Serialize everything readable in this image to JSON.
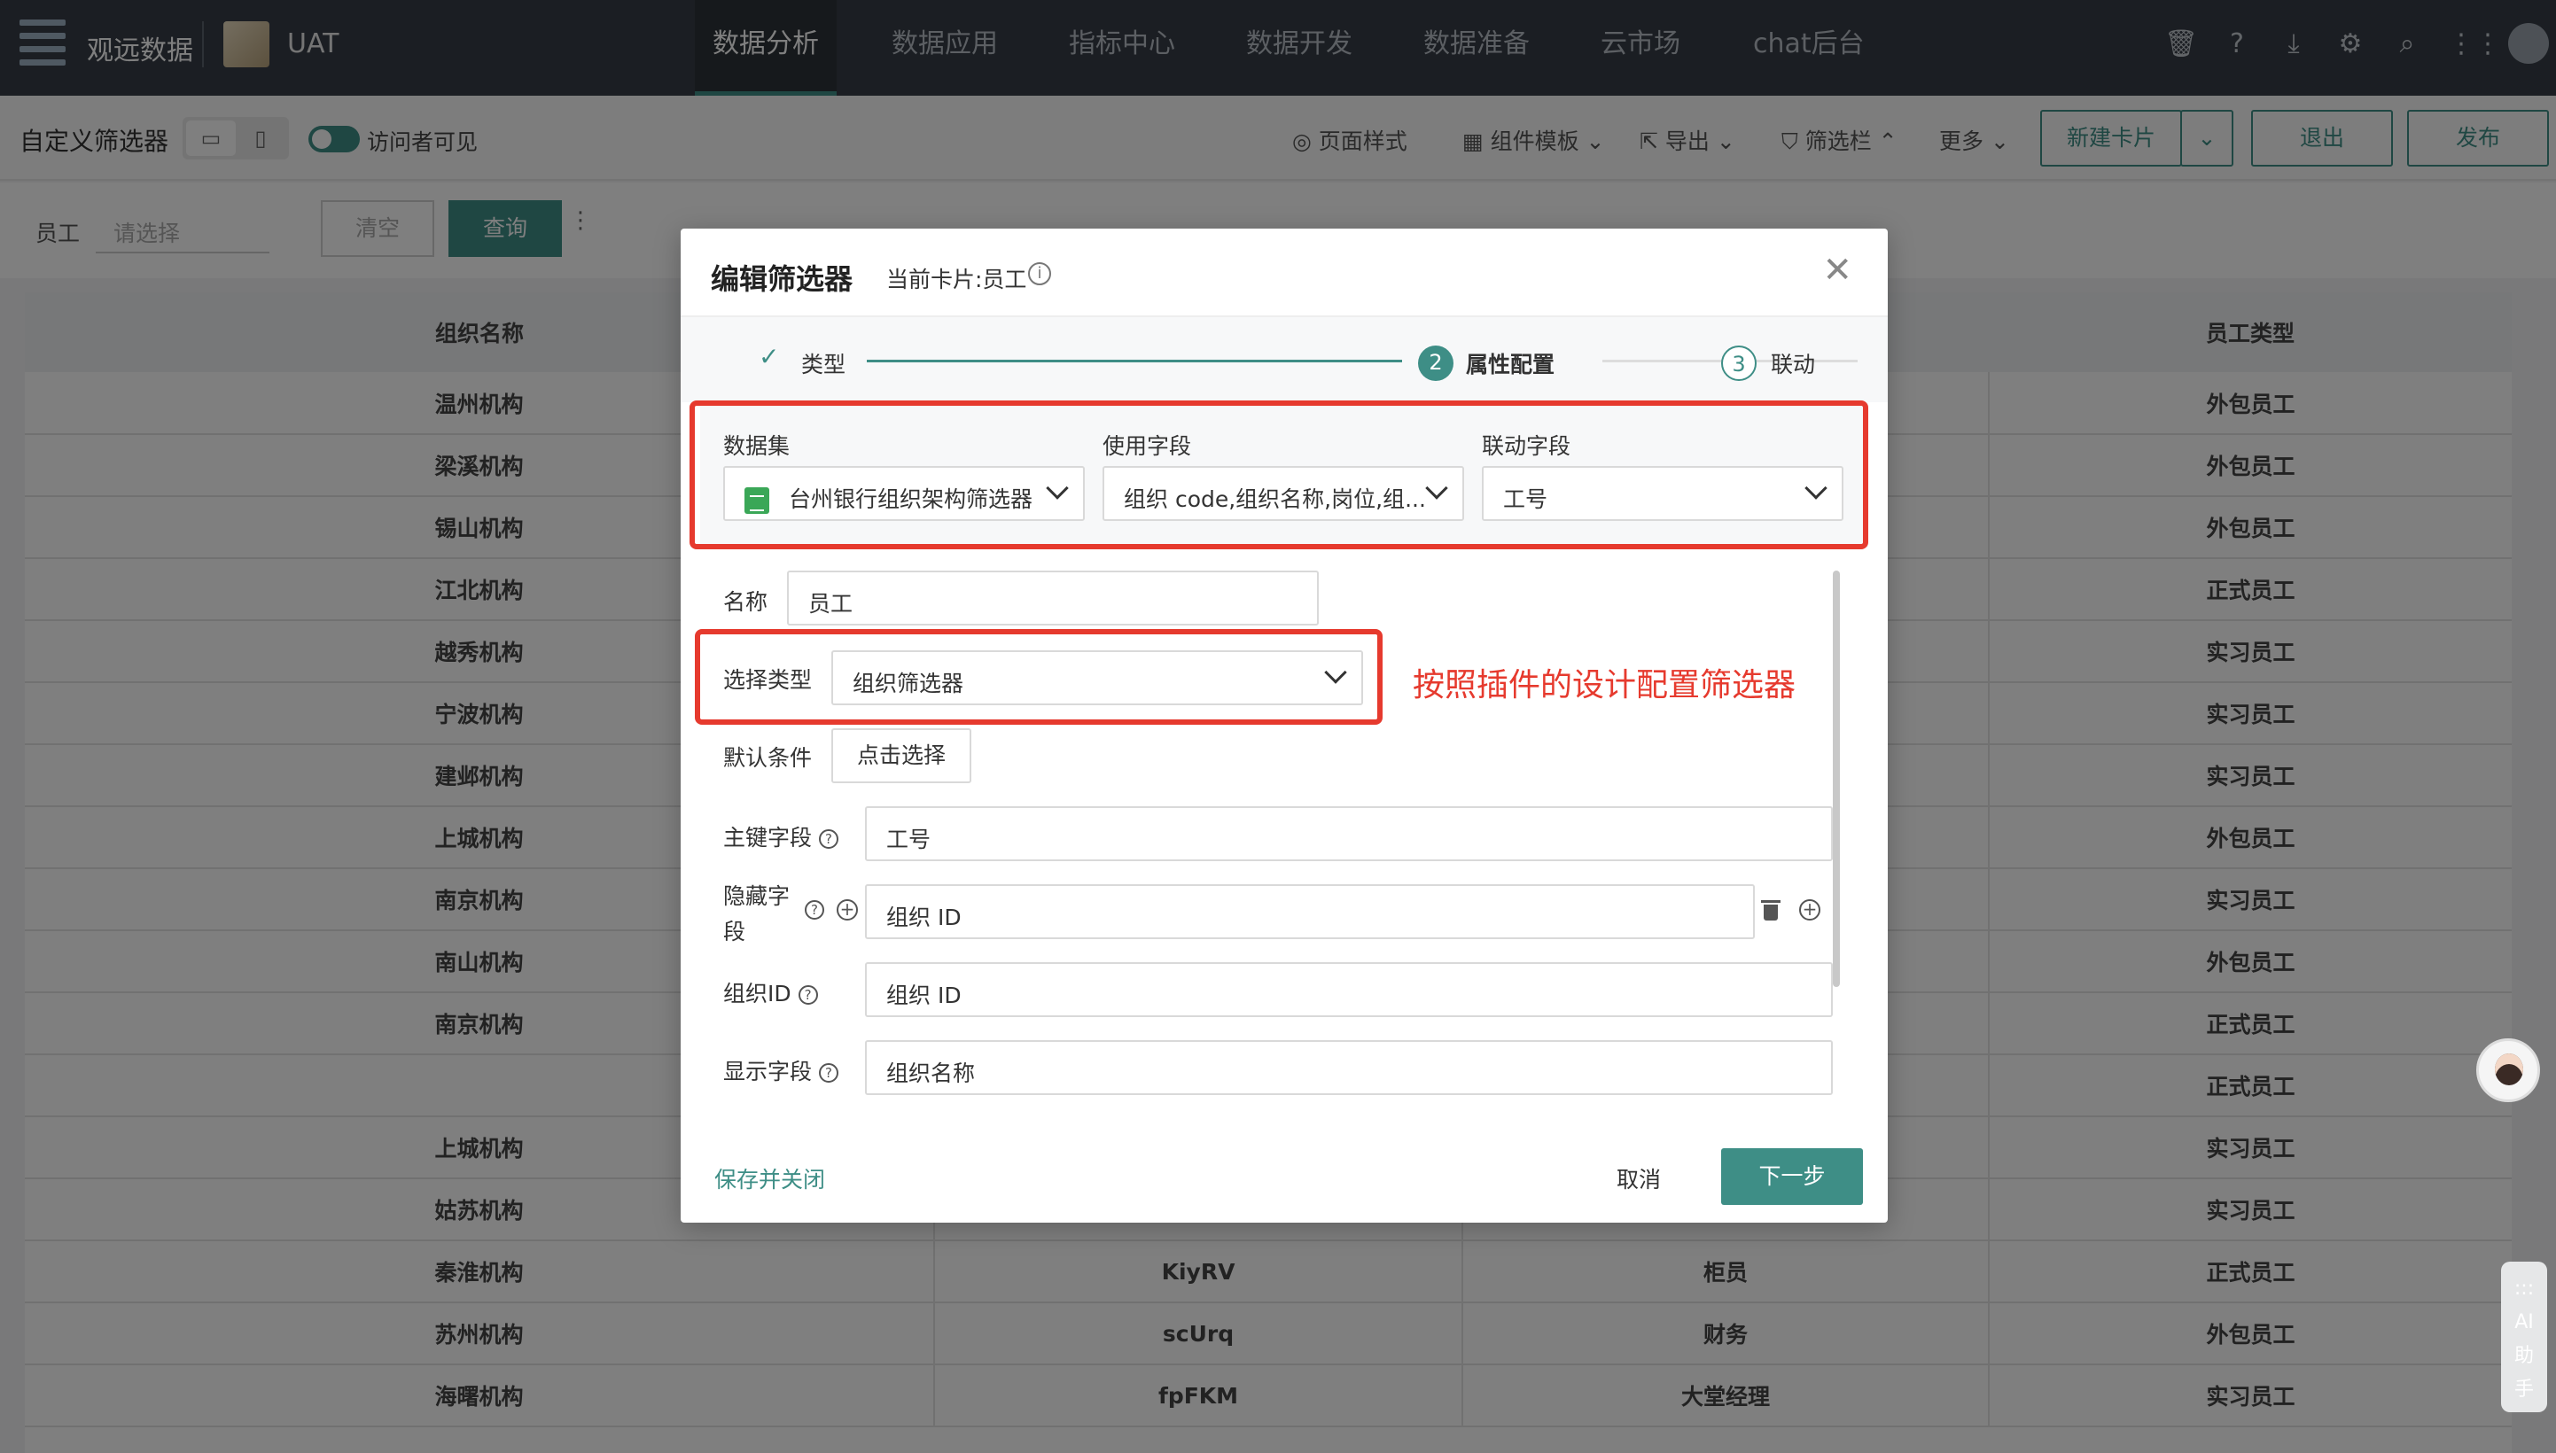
{
  "topbar": {
    "brand": "观远数据",
    "env": "UAT",
    "nav": [
      "数据分析",
      "数据应用",
      "指标中心",
      "数据开发",
      "数据准备",
      "云市场",
      "chat后台"
    ],
    "icons": [
      "trash-icon",
      "help-icon",
      "download-icon",
      "settings-icon",
      "search-icon",
      "apps-grid-icon",
      "user-avatar"
    ]
  },
  "toolbar": {
    "page_name": "自定义筛选器",
    "visitor_visible": "访问者可见",
    "page_style": "页面样式",
    "component_template": "组件模板",
    "export": "导出",
    "filter_bar": "筛选栏",
    "more": "更多",
    "new_card": "新建卡片",
    "exit": "退出",
    "publish": "发布"
  },
  "filterbar": {
    "label": "员工",
    "placeholder": "请选择",
    "clear": "清空",
    "query": "查询"
  },
  "table": {
    "headers": [
      "组织名称",
      "",
      "",
      "员工类型"
    ],
    "rows": [
      [
        "温州机构",
        "",
        "",
        "外包员工"
      ],
      [
        "梁溪机构",
        "",
        "",
        "外包员工"
      ],
      [
        "锡山机构",
        "",
        "",
        "外包员工"
      ],
      [
        "江北机构",
        "",
        "",
        "正式员工"
      ],
      [
        "越秀机构",
        "",
        "",
        "实习员工"
      ],
      [
        "宁波机构",
        "",
        "",
        "实习员工"
      ],
      [
        "建邺机构",
        "",
        "",
        "实习员工"
      ],
      [
        "上城机构",
        "",
        "",
        "外包员工"
      ],
      [
        "南京机构",
        "",
        "",
        "实习员工"
      ],
      [
        "南山机构",
        "",
        "",
        "外包员工"
      ],
      [
        "南京机构",
        "",
        "",
        "正式员工"
      ],
      [
        "",
        "",
        "",
        "正式员工"
      ],
      [
        "上城机构",
        "",
        "",
        "实习员工"
      ],
      [
        "姑苏机构",
        "",
        "",
        "实习员工"
      ],
      [
        "秦淮机构",
        "KiyRV",
        "柜员",
        "正式员工"
      ],
      [
        "苏州机构",
        "scUrq",
        "财务",
        "外包员工"
      ],
      [
        "海曙机构",
        "fpFKM",
        "大堂经理",
        "实习员工"
      ]
    ]
  },
  "modal": {
    "title": "编辑筛选器",
    "subtitle": "当前卡片:员工",
    "steps": [
      {
        "num": "",
        "label": "类型"
      },
      {
        "num": "2",
        "label": "属性配置"
      },
      {
        "num": "3",
        "label": "联动"
      }
    ],
    "dataset_label": "数据集",
    "dataset_value": "台州银行组织架构筛选器",
    "fields_label": "使用字段",
    "fields_value": "组织 code,组织名称,岗位,组...",
    "link_label": "联动字段",
    "link_value": "工号",
    "name_label": "名称",
    "name_value": "员工",
    "select_type_label": "选择类型",
    "select_type_value": "组织筛选器",
    "default_cond_label": "默认条件",
    "default_cond_btn": "点击选择",
    "pk_label": "主键字段",
    "pk_value": "工号",
    "hidden_label_1": "隐藏字",
    "hidden_label_2": "段",
    "hidden_value": "组织 ID",
    "orgid_label": "组织ID",
    "orgid_value": "组织 ID",
    "display_label": "显示字段",
    "display_value": "组织名称",
    "save_close": "保存并关闭",
    "cancel": "取消",
    "next": "下一步"
  },
  "annotation": "按照插件的设计配置筛选器",
  "ai_helper": {
    "dots": ":::",
    "label_1": "AI",
    "label_2": "助",
    "label_3": "手"
  },
  "colors": {
    "accent": "#3e8e86",
    "highlight": "#e63a2e",
    "topbar": "#363d46"
  }
}
